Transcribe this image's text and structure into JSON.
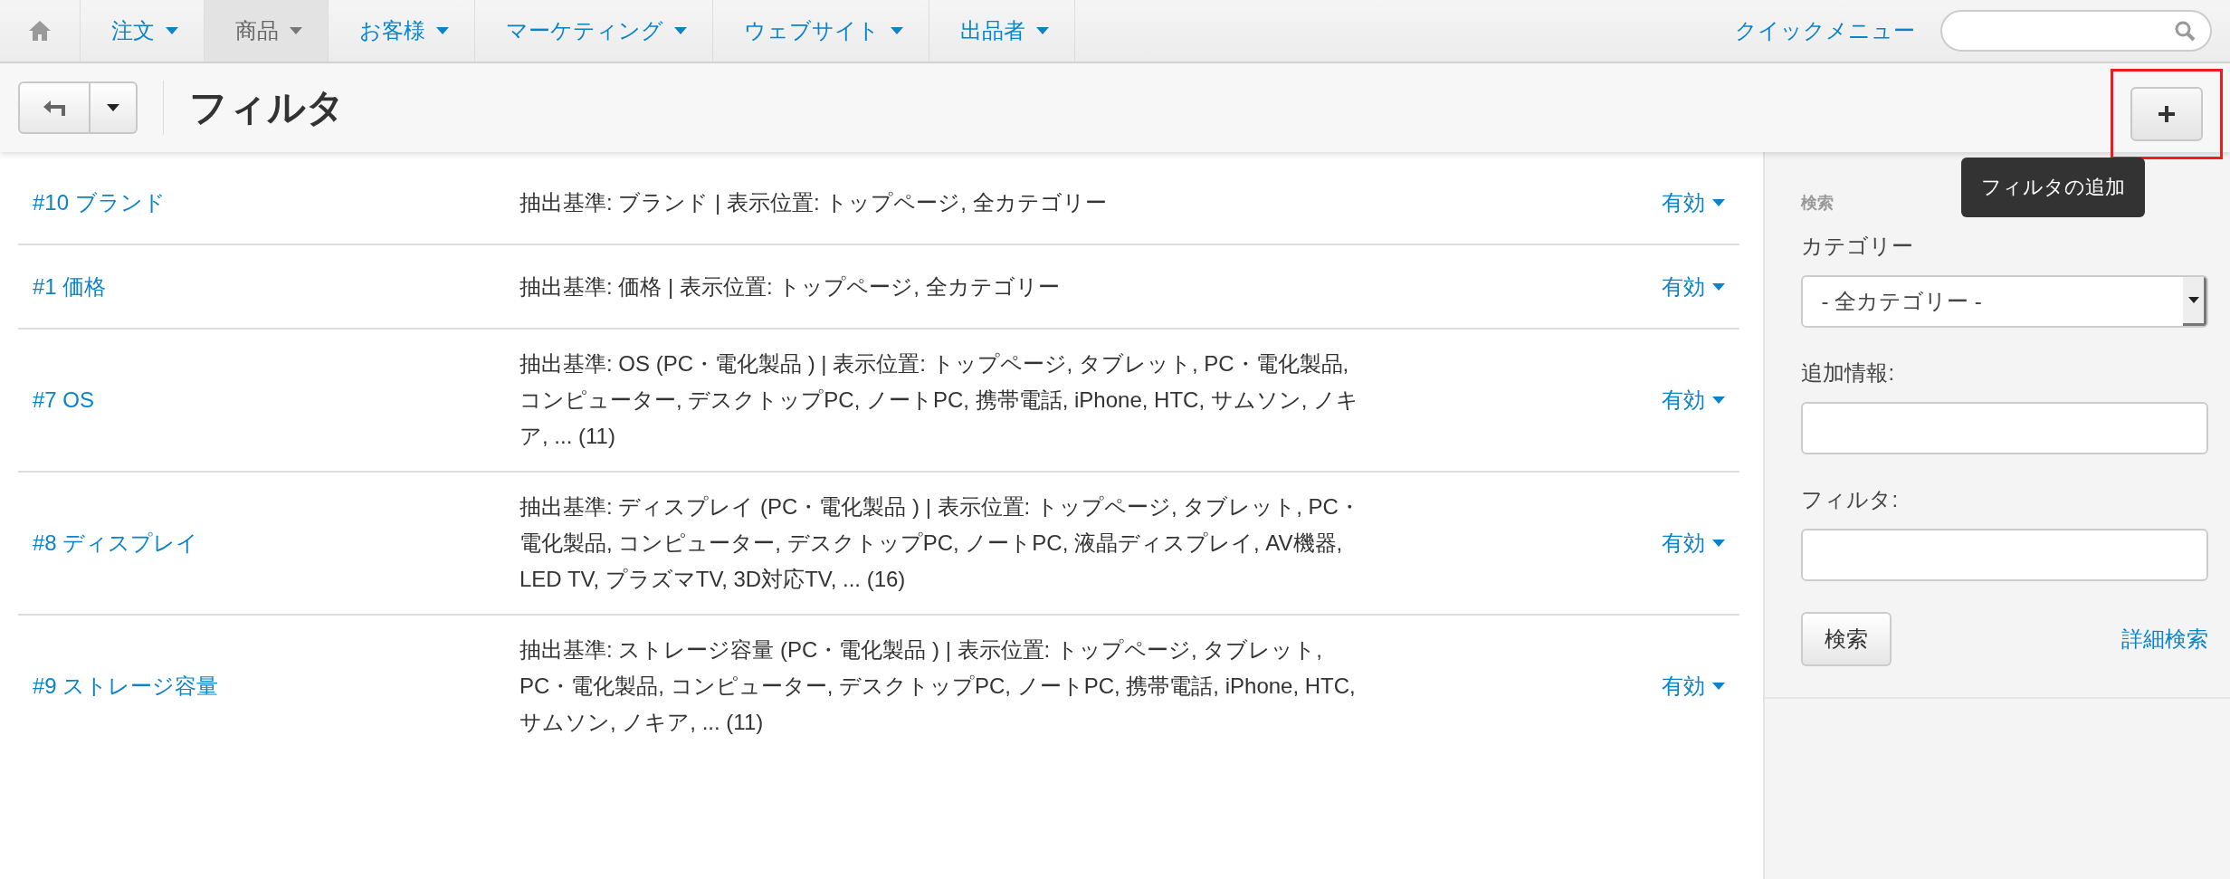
{
  "nav": {
    "items": [
      {
        "label": "注文",
        "selected": false
      },
      {
        "label": "商品",
        "selected": true
      },
      {
        "label": "お客様",
        "selected": false
      },
      {
        "label": "マーケティング",
        "selected": false
      },
      {
        "label": "ウェブサイト",
        "selected": false
      },
      {
        "label": "出品者",
        "selected": false
      }
    ],
    "quick_menu": "クイックメニュー"
  },
  "toolbar": {
    "title": "フィルタ",
    "tooltip": "フィルタの追加"
  },
  "filters": [
    {
      "name": "#10 ブランド",
      "description": "抽出基準: ブランド | 表示位置: トップページ, 全カテゴリー",
      "status": "有効"
    },
    {
      "name": "#1 価格",
      "description": "抽出基準: 価格 | 表示位置: トップページ, 全カテゴリー",
      "status": "有効"
    },
    {
      "name": "#7 OS",
      "description": "抽出基準: OS (PC・電化製品 ) | 表示位置: トップページ, タブレット, PC・電化製品, コンピューター, デスクトップPC, ノートPC, 携帯電話, iPhone, HTC, サムソン, ノキア, ... (11)",
      "status": "有効"
    },
    {
      "name": "#8 ディスプレイ",
      "description": "抽出基準: ディスプレイ (PC・電化製品 ) | 表示位置: トップページ, タブレット, PC・電化製品, コンピューター, デスクトップPC, ノートPC, 液晶ディスプレイ, AV機器, LED TV, プラズマTV, 3D対応TV, ... (16)",
      "status": "有効"
    },
    {
      "name": "#9 ストレージ容量",
      "description": "抽出基準: ストレージ容量 (PC・電化製品 ) | 表示位置: トップページ, タブレット, PC・電化製品, コンピューター, デスクトップPC, ノートPC, 携帯電話, iPhone, HTC, サムソン, ノキア, ... (11)",
      "status": "有効"
    }
  ],
  "sidebar": {
    "heading": "検索",
    "category_label": "カテゴリー",
    "category_value": "- 全カテゴリー -",
    "extra_label": "追加情報:",
    "filter_label": "フィルタ:",
    "search_button": "検索",
    "advanced_link": "詳細検索"
  }
}
